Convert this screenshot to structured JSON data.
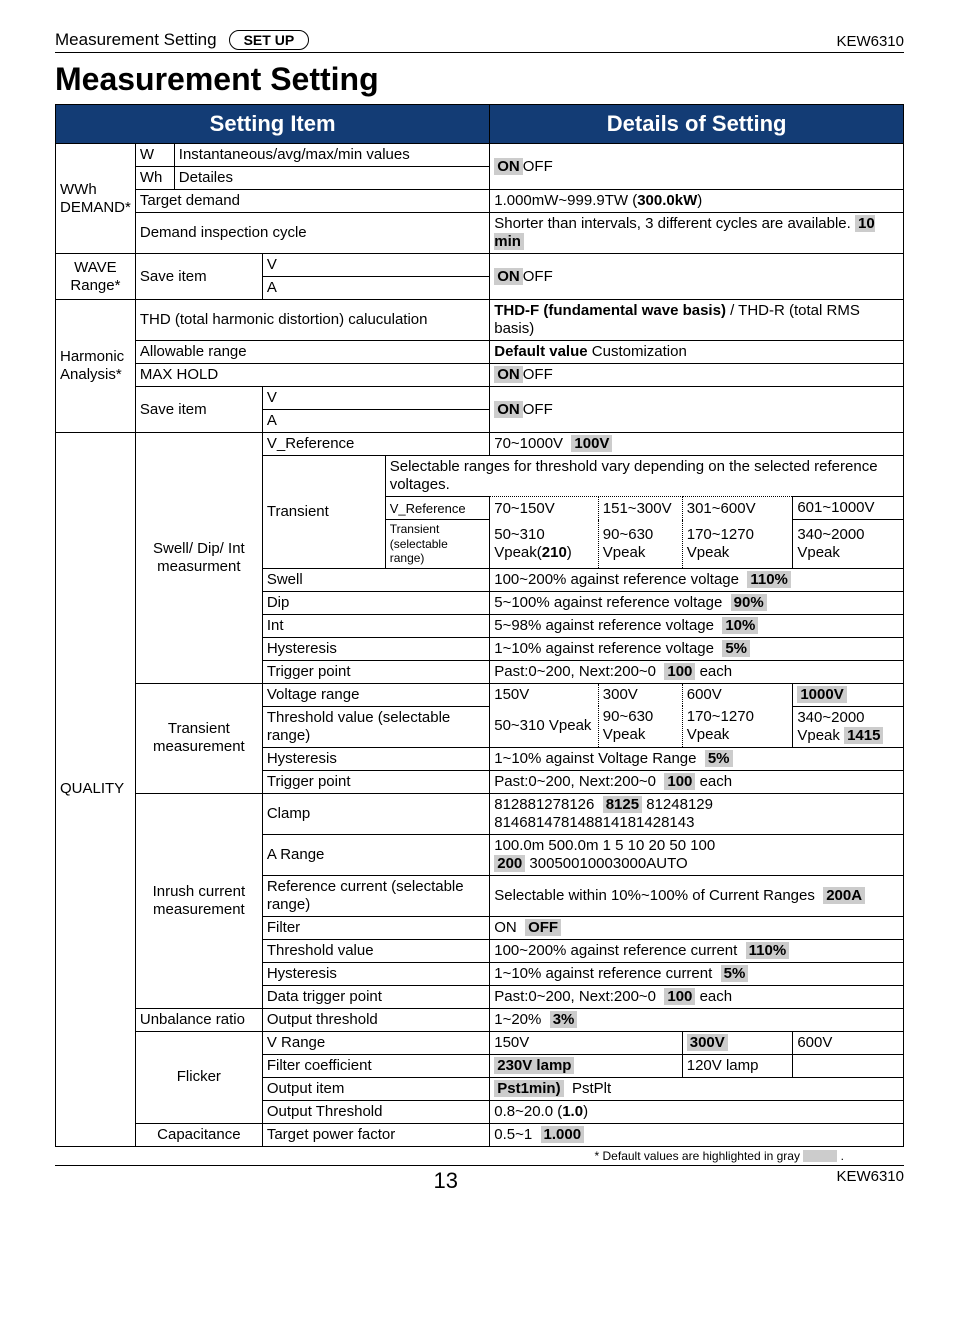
{
  "header": {
    "section": "Measurement Setting",
    "setup": "SET UP",
    "model": "KEW6310"
  },
  "title": "Measurement Setting",
  "colhead": {
    "a": "Setting Item",
    "b": "Details of Setting"
  },
  "wwh": {
    "label": "WWh DEMAND*",
    "w": "W",
    "wh": "Wh",
    "wdesc": "Instantaneous/avg/max/min values",
    "whdesc": "Detailes",
    "targetdemand": "Target demand",
    "targetdemand_val_a": "1.000mW~999.9TW (",
    "targetdemand_val_b": "300.0kW",
    "targetdemand_val_c": ")",
    "cycle": "Demand inspection cycle",
    "cycle_val_a": "Shorter than intervals, 3 different cycles are available.",
    "cycle_val_b": "10 min",
    "onoff_on": "ON",
    "onoff_off": "OFF"
  },
  "wave": {
    "label": "WAVE Range*",
    "save": "Save item",
    "v": "V",
    "a": "A",
    "on": "ON",
    "off": "OFF"
  },
  "harm": {
    "label": "Harmonic Analysis*",
    "thd": "THD (total harmonic distortion) caluculation",
    "thd_a": "THD-F (fundamental wave basis)",
    "thd_b": " / THD-R (total RMS basis)",
    "allow": "Allowable range",
    "allow_val": "Default value",
    "allow_val2": " Customization",
    "max": "MAX HOLD",
    "on": "ON",
    "off": "OFF",
    "save": "Save item",
    "v": "V",
    "a": "A"
  },
  "quality": {
    "label": "QUALITY",
    "swell_label": "Swell/ Dip/ Int measurment",
    "vref": "V_Reference",
    "vref_val_a": "70~1000V",
    "vref_val_b": "100V",
    "trans": "Transient",
    "trans_val": "Selectable ranges for threshold vary depending on the selected reference voltages.",
    "sub_vref": "V_Reference",
    "sub_vref_cells": [
      "70~150V",
      "151~300V",
      "301~600V",
      "601~1000V"
    ],
    "sub_trans": "Transient (selectable range)",
    "sub_trans_cells": [
      "50~310 Vpeak(210)",
      "90~630 Vpeak",
      "170~1270 Vpeak",
      "340~2000 Vpeak"
    ],
    "swell": "Swell",
    "swell_val_a": "100~200% against reference voltage",
    "swell_val_b": "110%",
    "dip": "Dip",
    "dip_val_a": "5~100% against reference voltage",
    "dip_val_b": "90%",
    "int": "Int",
    "int_val_a": "5~98% against reference voltage",
    "int_val_b": "10%",
    "hyst": "Hysteresis",
    "hyst_val_a": "1~10% against reference voltage",
    "hyst_val_b": "5%",
    "trig": "Trigger point",
    "trig_val_a": "Past:0~200, Next:200~0",
    "trig_val_b": "100",
    "trig_val_c": " each",
    "tm_label": "Transient measurement",
    "vrange": "Voltage range",
    "vrange_cells": [
      "150V",
      "300V",
      "600V",
      "1000V"
    ],
    "thresh": "Threshold value (selectable range)",
    "thresh_cells": [
      "50~310 Vpeak",
      "90~630 Vpeak",
      "170~1270 Vpeak",
      "340~2000 Vpeak"
    ],
    "thresh_hl": "1415",
    "tm_hyst": "Hysteresis",
    "tm_hyst_a": "1~10% against Voltage Range",
    "tm_hyst_b": "5%",
    "tm_trig": "Trigger point",
    "tm_trig_a": "Past:0~200, Next:200~0",
    "tm_trig_b": "100",
    "tm_trig_c": " each",
    "inrush_label": "Inrush current measurement",
    "clamp": "Clamp",
    "clamp_val_a": "812881278126",
    "clamp_val_b": "8125",
    "clamp_val_c": " 81248129 81468147814881418142814",
    "arange": "A Range",
    "arange_val_a": "100.0m  500.0m  1  5  10  20  50  100",
    "arange_val_b": "200",
    "arange_val_c": " 30050010003000AUTO",
    "refcur": "Reference current (selectable range)",
    "refcur_a": "Selectable within 10%~100% of Current Ranges",
    "refcur_b": "200A",
    "filter": "Filter",
    "filter_a": "ON",
    "filter_b": "OFF",
    "ithresh": "Threshold value",
    "ithresh_a": "100~200% against reference current",
    "ithresh_b": "110%",
    "ihyst": "Hysteresis",
    "ihyst_a": "1~10% against reference current",
    "ihyst_b": "5%",
    "dtrig": "Data trigger point",
    "dtrig_a": "Past:0~200, Next:200~0",
    "dtrig_b": "100",
    "dtrig_c": " each",
    "unbal": "Unbalance ratio",
    "unbal_item": "Output threshold",
    "unbal_a": "1~20%",
    "unbal_b": "3%",
    "flicker": "Flicker",
    "f_vrange": "V Range",
    "f_vrange_cells": [
      "150V",
      "300V",
      "600V"
    ],
    "f_coef": "Filter coefficient",
    "f_coef_a": "230V lamp",
    "f_coef_b": "120V lamp",
    "f_out": "Output item",
    "f_out_a": "Pst1min)",
    "f_out_b": "PstPlt",
    "f_thresh": "Output Threshold",
    "f_thresh_a": "0.8~20.0 (",
    "f_thresh_b": "1.0",
    "f_thresh_c": ")",
    "cap": "Capacitance",
    "cap_item": "Target power factor",
    "cap_a": "0.5~1",
    "cap_b": "1.000"
  },
  "footnote": "* Default values are highlighted in gray",
  "pagenum": "13"
}
